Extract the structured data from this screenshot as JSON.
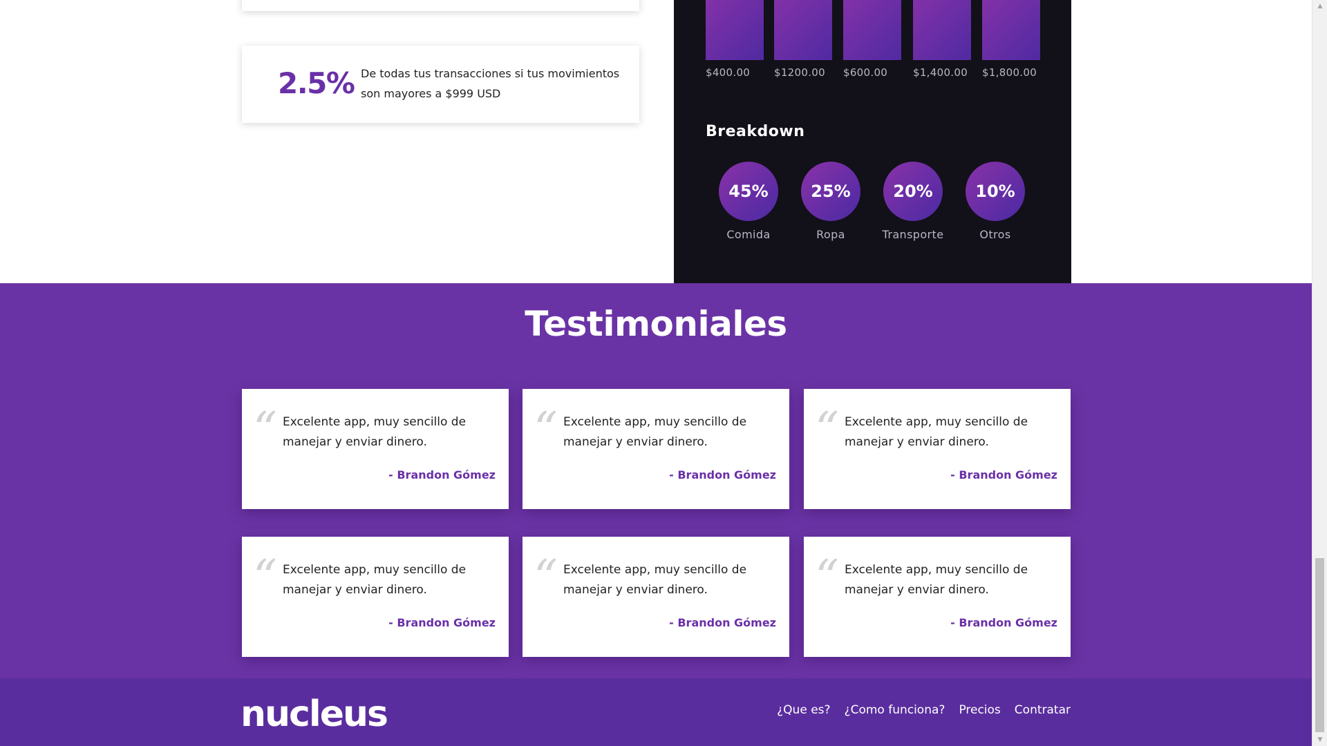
{
  "fees": {
    "partial_card": {},
    "card": {
      "percent": "2.5%",
      "description": "De todas tus transacciones si tus movimientos son mayores a $999 USD"
    }
  },
  "dashboard": {
    "bars": [
      {
        "label": "$400.00"
      },
      {
        "label": "$1200.00"
      },
      {
        "label": "$600.00"
      },
      {
        "label": "$1,400.00"
      },
      {
        "label": "$1,800.00"
      }
    ],
    "breakdown": {
      "title": "Breakdown",
      "items": [
        {
          "value": "45%",
          "label": "Comida"
        },
        {
          "value": "25%",
          "label": "Ropa"
        },
        {
          "value": "20%",
          "label": "Transporte"
        },
        {
          "value": "10%",
          "label": "Otros"
        }
      ]
    }
  },
  "testimonials": {
    "title": "Testimoniales",
    "quote_icon": "“",
    "items": [
      {
        "text": "Excelente app, muy sencillo de manejar y enviar dinero.",
        "author": "- Brandon Gómez"
      },
      {
        "text": "Excelente app, muy sencillo de manejar y enviar dinero.",
        "author": "- Brandon Gómez"
      },
      {
        "text": "Excelente app, muy sencillo de manejar y enviar dinero.",
        "author": "- Brandon Gómez"
      },
      {
        "text": "Excelente app, muy sencillo de manejar y enviar dinero.",
        "author": "- Brandon Gómez"
      },
      {
        "text": "Excelente app, muy sencillo de manejar y enviar dinero.",
        "author": "- Brandon Gómez"
      },
      {
        "text": "Excelente app, muy sencillo de manejar y enviar dinero.",
        "author": "- Brandon Gómez"
      }
    ]
  },
  "footer": {
    "logo": "nucleus",
    "nav": [
      {
        "label": "¿Que es?"
      },
      {
        "label": "¿Como funciona?"
      },
      {
        "label": "Precios"
      },
      {
        "label": "Contratar"
      }
    ]
  },
  "colors": {
    "accent": "#6a30a8",
    "testimonials_bg": "#6a33a5",
    "footer_bg": "#5a2d9e",
    "dark_panel": "#121019"
  }
}
